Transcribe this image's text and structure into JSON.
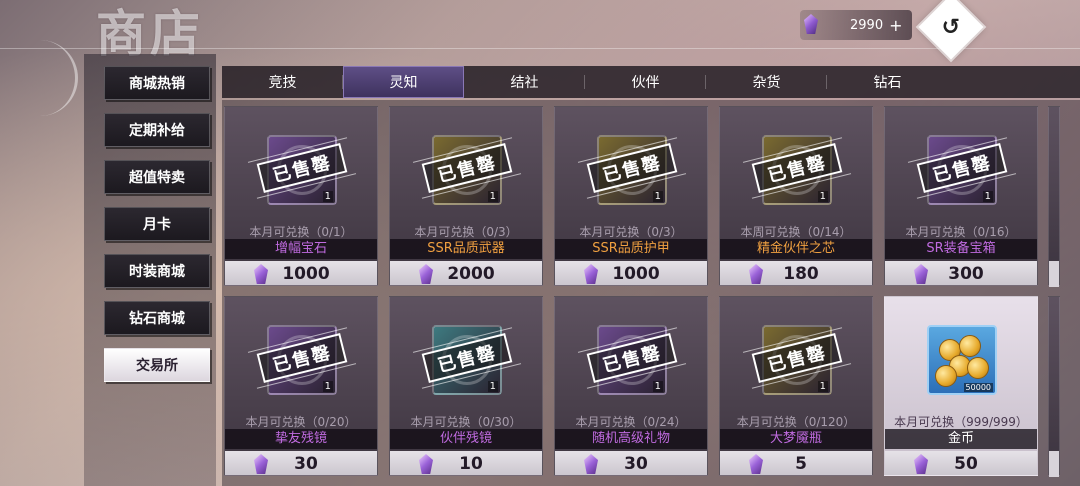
{
  "header": {
    "title": "商店",
    "currency_value": "2990",
    "currency_icon": "purple-gem-icon",
    "plus_icon": "+",
    "back_icon": "↺"
  },
  "sidebar": {
    "items": [
      {
        "label": "商城热销",
        "active": false
      },
      {
        "label": "定期补给",
        "active": false
      },
      {
        "label": "超值特卖",
        "active": false
      },
      {
        "label": "月卡",
        "active": false
      },
      {
        "label": "时装商城",
        "active": false
      },
      {
        "label": "钻石商城",
        "active": false
      },
      {
        "label": "交易所",
        "active": true
      }
    ]
  },
  "tabs": [
    {
      "label": "竞技",
      "active": false
    },
    {
      "label": "灵知",
      "active": true
    },
    {
      "label": "结社",
      "active": false
    },
    {
      "label": "伙伴",
      "active": false
    },
    {
      "label": "杂货",
      "active": false
    },
    {
      "label": "钻石",
      "active": false
    }
  ],
  "items": [
    {
      "name": "增幅宝石",
      "limit": "本月可兑换（0/1）",
      "price": "1000",
      "qty": "1",
      "sold_out": true,
      "sold_label": "已售罄",
      "name_color": "purple",
      "icon_color": "#6b4a8c"
    },
    {
      "name": "SSR品质武器",
      "limit": "本月可兑换（0/3）",
      "price": "2000",
      "qty": "1",
      "sold_out": true,
      "sold_label": "已售罄",
      "name_color": "orange",
      "icon_color": "#7a6a30"
    },
    {
      "name": "SSR品质护甲",
      "limit": "本月可兑换（0/3）",
      "price": "1000",
      "qty": "1",
      "sold_out": true,
      "sold_label": "已售罄",
      "name_color": "orange",
      "icon_color": "#7a6a30"
    },
    {
      "name": "精金伙伴之芯",
      "limit": "本周可兑换（0/14）",
      "price": "180",
      "qty": "1",
      "sold_out": true,
      "sold_label": "已售罄",
      "name_color": "orange",
      "icon_color": "#7a6a30"
    },
    {
      "name": "SR装备宝箱",
      "limit": "本月可兑换（0/16）",
      "price": "300",
      "qty": "1",
      "sold_out": true,
      "sold_label": "已售罄",
      "name_color": "purple",
      "icon_color": "#6b4a8c"
    },
    {
      "name": "挚友残镜",
      "limit": "本月可兑换（0/20）",
      "price": "30",
      "qty": "1",
      "sold_out": true,
      "sold_label": "已售罄",
      "name_color": "purple",
      "icon_color": "#6b4a8c"
    },
    {
      "name": "伙伴残镜",
      "limit": "本月可兑换（0/30）",
      "price": "10",
      "qty": "1",
      "sold_out": true,
      "sold_label": "已售罄",
      "name_color": "purple",
      "icon_color": "#3e7a80"
    },
    {
      "name": "随机高级礼物",
      "limit": "本月可兑换（0/24）",
      "price": "30",
      "qty": "1",
      "sold_out": true,
      "sold_label": "已售罄",
      "name_color": "purple",
      "icon_color": "#6b4a8c"
    },
    {
      "name": "大梦魇瓶",
      "limit": "本月可兑换（0/120）",
      "price": "5",
      "qty": "1",
      "sold_out": true,
      "sold_label": "已售罄",
      "name_color": "purple",
      "icon_color": "#7a6a30"
    },
    {
      "name": "金币",
      "limit": "本月可兑换（999/999）",
      "price": "50",
      "qty": "50000",
      "sold_out": false,
      "sold_label": "",
      "name_color": "white",
      "icon_color": "#3a8ad0"
    }
  ]
}
